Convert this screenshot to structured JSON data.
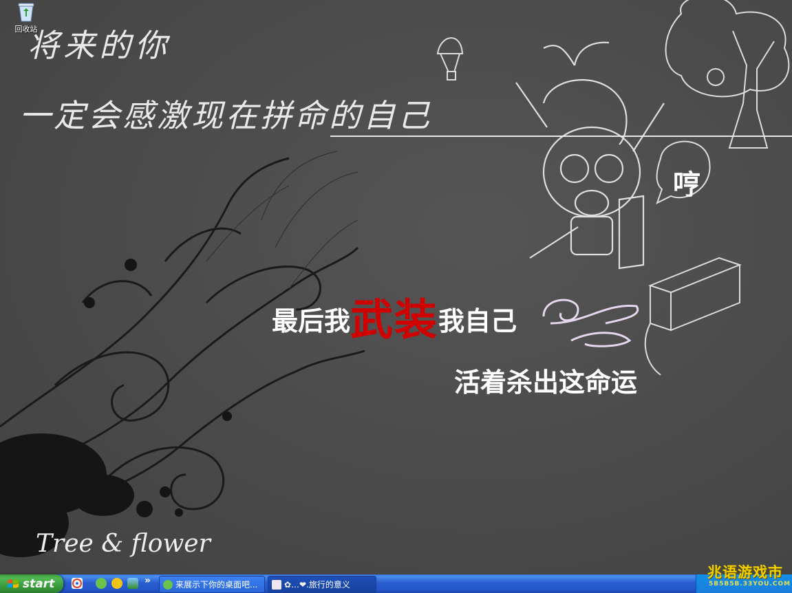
{
  "desktop": {
    "icons": [
      {
        "label": "回收站",
        "icon": "recycle-bin-icon"
      }
    ],
    "wallpaper": {
      "handwriting_line1": "将来的你",
      "handwriting_line2": "一定会感激现在拼命的自己",
      "slogan_part1": "最后我",
      "slogan_red": "武装",
      "slogan_part2": "我自己",
      "slogan_line2": "活着杀出这命运",
      "bubble_text": "哼",
      "signature": "Tree & flower",
      "colors": {
        "background": "#4b4b4b",
        "accent_red": "#d00000",
        "chalk": "#e9e9e9"
      }
    }
  },
  "taskbar": {
    "start_label": "start",
    "quick_launch": [
      "ie-icon",
      "browser-icon",
      "desktop-icon"
    ],
    "chevron": "»",
    "tasks": [
      {
        "label": "来展示下你的桌面吧...",
        "icon": "browser-icon",
        "active": true
      },
      {
        "label": "✿…❤.旅行的意义",
        "icon": "window-icon",
        "active": false
      }
    ],
    "watermark_title": "兆语游戏市",
    "watermark_url": "5B5B5B.33YOU.COM"
  }
}
